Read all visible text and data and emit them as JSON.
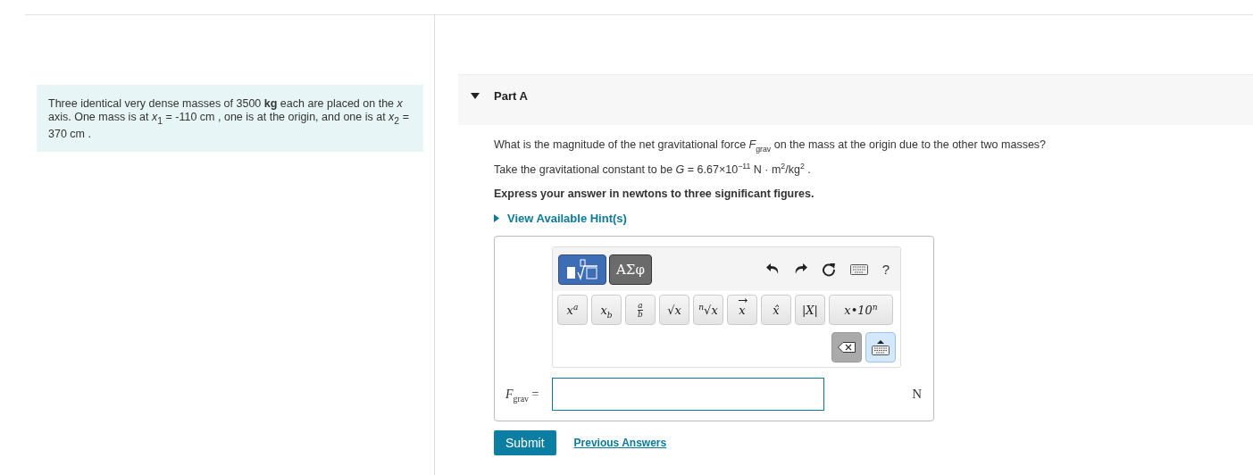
{
  "problem_intro": "Three identical very dense masses of 3500 **kg** each are placed on the *x* axis. One mass is at *x*$_{1}$ = -110 cm , one is at the origin, and one is at *x*$_{2}$ = 370 cm .",
  "part": {
    "title": "Part A",
    "expanded": true,
    "question": "What is the magnitude of the net gravitational force *F*$_{grav}$ on the mass at the origin due to the other two masses?",
    "constant": "Take the gravitational constant to be *G* = 6.67×10$^{−11}$ N · m$^{2}$/kg$^{2}$ .",
    "instruction": "Express your answer in newtons to three significant figures.",
    "hint": {
      "label": "View Available Hint(s)",
      "expanded": false
    },
    "editor": {
      "modes": [
        {
          "kind": "templates",
          "selected": true
        },
        {
          "kind": "greek",
          "label": "ΑΣφ",
          "selected": false
        }
      ],
      "tools": [
        {
          "kind": "undo"
        },
        {
          "kind": "redo"
        },
        {
          "kind": "reset"
        },
        {
          "kind": "keyboard"
        },
        {
          "kind": "help",
          "label": "?"
        }
      ],
      "keys": [
        {
          "kind": "plain",
          "label": "*x*$^{a}$"
        },
        {
          "kind": "plain",
          "label": "*x*$_{b}$"
        },
        {
          "kind": "fraction",
          "num": "a",
          "den": "b"
        },
        {
          "kind": "plain",
          "label": "√*x*"
        },
        {
          "kind": "plain",
          "label": "$^{n}$√*x*"
        },
        {
          "kind": "vector",
          "label": "x"
        },
        {
          "kind": "plain",
          "label": "x̂"
        },
        {
          "kind": "plain",
          "label": "|X|"
        },
        {
          "kind": "plain",
          "label": "*x*•*10*$^{n}$"
        }
      ]
    },
    "answer": {
      "label": "*F*$_{grav}$ =",
      "unit": "N"
    },
    "buttons": [
      {
        "kind": "primary",
        "label": "Submit"
      },
      {
        "kind": "link",
        "label": "Previous Answers"
      }
    ]
  }
}
